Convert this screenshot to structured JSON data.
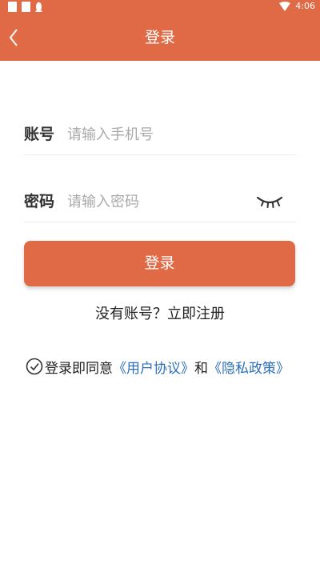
{
  "status_bar": {
    "time": "4:06"
  },
  "header": {
    "title": "登录",
    "back_icon": "chevron-left-icon"
  },
  "form": {
    "account_label": "账号",
    "account_placeholder": "请输入手机号",
    "password_label": "密码",
    "password_placeholder": "请输入密码",
    "eye_icon": "eye-closed-icon"
  },
  "login_button": "登录",
  "register_link": "没有账号？立即注册",
  "agreement": {
    "prefix": "登录即同意",
    "user_agreement": "《用户协议》",
    "connector": "和",
    "privacy_policy": "《隐私政策》"
  },
  "colors": {
    "primary": "#e06a45",
    "link": "#2d6fb7"
  }
}
